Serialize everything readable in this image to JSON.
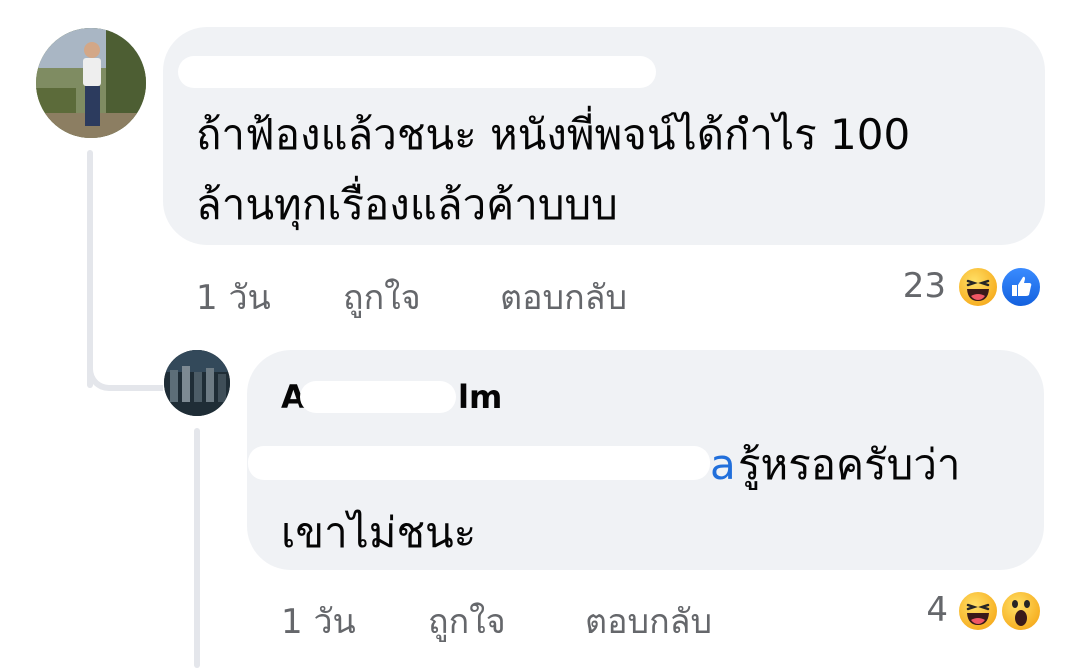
{
  "comments": [
    {
      "author": "",
      "text_line1": "ถ้าฟ้องแล้วชนะ หนังพี่พจน์ได้กำไร 100",
      "text_line2": "ล้านทุกเรื่องแล้วค้าบบบ",
      "time": "1 วัน",
      "like_label": "ถูกใจ",
      "reply_label": "ตอบกลับ",
      "reaction_count": "23",
      "reactions": [
        "haha-reaction-icon",
        "like-reaction-icon"
      ]
    },
    {
      "author_prefix": "A",
      "author_suffix": "lm",
      "mention_tail": "a",
      "text_line1_rest": " รู้หรอครับว่า",
      "text_line2": "เขาไม่ชนะ",
      "time": "1 วัน",
      "like_label": "ถูกใจ",
      "reply_label": "ตอบกลับ",
      "reaction_count": "4",
      "reactions": [
        "haha-reaction-icon",
        "wow-reaction-icon"
      ]
    }
  ],
  "colors": {
    "bubble": "#f0f2f5",
    "secondary_text": "#65676b",
    "mention": "#216fdb",
    "like_blue": "#1877f2"
  }
}
